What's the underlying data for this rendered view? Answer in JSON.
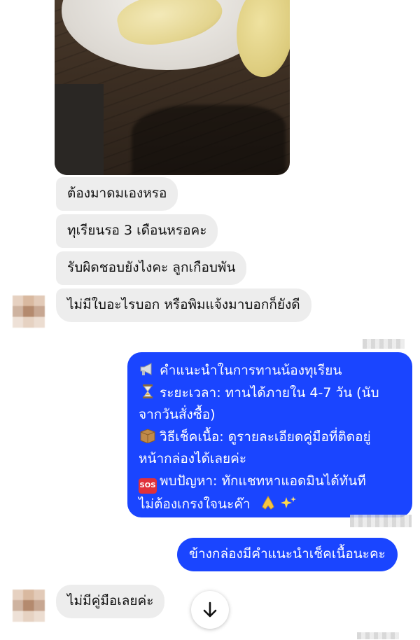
{
  "conversation": {
    "incoming": [
      {
        "text": "ต้องมาดมเองหรอ"
      },
      {
        "text": "ทุเรียนรอ 3 เดือนหรอคะ"
      },
      {
        "text": "รับผิดชอบยังไงคะ ลูกเกือบพัน"
      },
      {
        "text": "ไม่มีใบอะไรบอก หรือพิมแจ้งมาบอกก็ยังดี"
      }
    ],
    "outgoing_notice": {
      "line1": "คำแนะนำในการทานน้องทุเรียน",
      "line2": "ระยะเวลา: ทานได้ภายใน 4-7 วัน (นับ",
      "line3": "จากวันสั่งซื้อ)",
      "line4": "วิธีเช็คเนื้อ: ดูรายละเอียดคู่มือที่ติดอยู่",
      "line5": "หน้ากล่องได้เลยค่ะ",
      "line6": "พบปัญหา: ทักแชทหาแอดมินได้ทันที",
      "line7": "ไม่ต้องเกรงใจนะค๊า",
      "sos_label": "SOS"
    },
    "outgoing_reply": {
      "text": "ข้างกล่องมีคำแนะนำเช็คเนื้อนะคะ"
    },
    "last_incoming": {
      "text": "ไม่มีคู่มือเลยค่ะ"
    }
  },
  "icons": {
    "notice": "megaphone-icon",
    "time": "hourglass-icon",
    "box": "package-icon",
    "problem": "sos-icon",
    "thanks": "folded-hands-icon",
    "sparkle": "sparkles-icon",
    "scroll": "arrow-down-icon"
  },
  "colors": {
    "outgoing_bubble": "#1a45ff",
    "incoming_bubble": "#ededed"
  }
}
